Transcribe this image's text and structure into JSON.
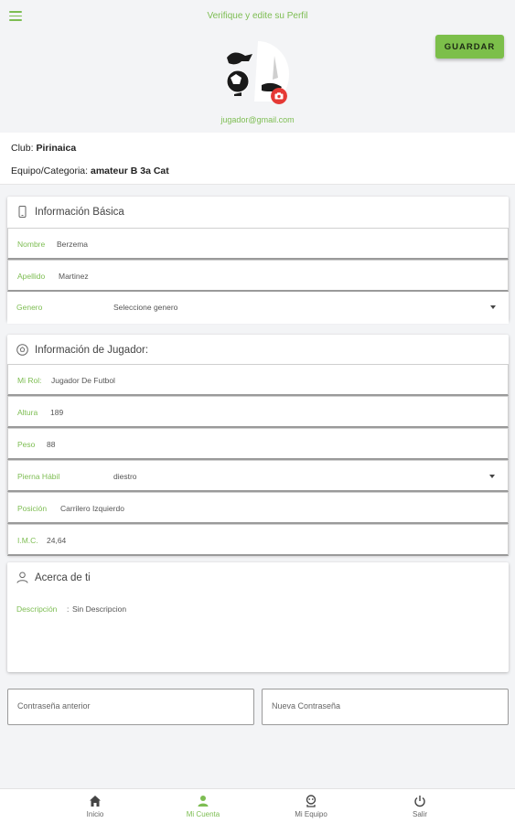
{
  "header": {
    "title": "Verifique y edite su Perfil",
    "save_label": "GUARDAR"
  },
  "profile": {
    "email": "jugador@gmail.com"
  },
  "club": {
    "club_label": "Club:",
    "club_value": "Pirinaica",
    "team_label": "Equipo/Categoria:",
    "team_value": "amateur B 3a Cat"
  },
  "basic_info": {
    "title": "Información Básica",
    "fields": [
      {
        "label": "Nombre",
        "value": "Berzema"
      },
      {
        "label": "Apellido",
        "value": "Martinez"
      },
      {
        "label": "Genero",
        "value": "Seleccione genero"
      }
    ]
  },
  "player_info": {
    "title": "Información de Jugador:",
    "fields": [
      {
        "label": "Mi Rol:",
        "value": "Jugador De Futbol"
      },
      {
        "label": "Altura",
        "value": "189"
      },
      {
        "label": "Peso",
        "value": "88"
      },
      {
        "label": "Pierna Hábil",
        "value": "diestro"
      },
      {
        "label": "Posición",
        "value": "Carrilero Izquierdo"
      },
      {
        "label": "I.M.C.",
        "value": "24,64"
      }
    ]
  },
  "about": {
    "title": "Acerca de ti",
    "description_label": "Descripción",
    "description_value": "Sin Descripcion"
  },
  "password": {
    "old_placeholder": "Contraseña anterior",
    "new_placeholder": "Nueva Contraseña"
  },
  "nav": [
    {
      "label": "Inicio",
      "icon": "home-icon"
    },
    {
      "label": "Mi Cuenta",
      "icon": "person-icon"
    },
    {
      "label": "Mi Equipo",
      "icon": "team-icon"
    },
    {
      "label": "Salir",
      "icon": "power-icon"
    }
  ],
  "colors": {
    "accent": "#7dbd52",
    "button": "#7cbf4a",
    "badge": "#e53935",
    "background": "#f3f4f6"
  }
}
